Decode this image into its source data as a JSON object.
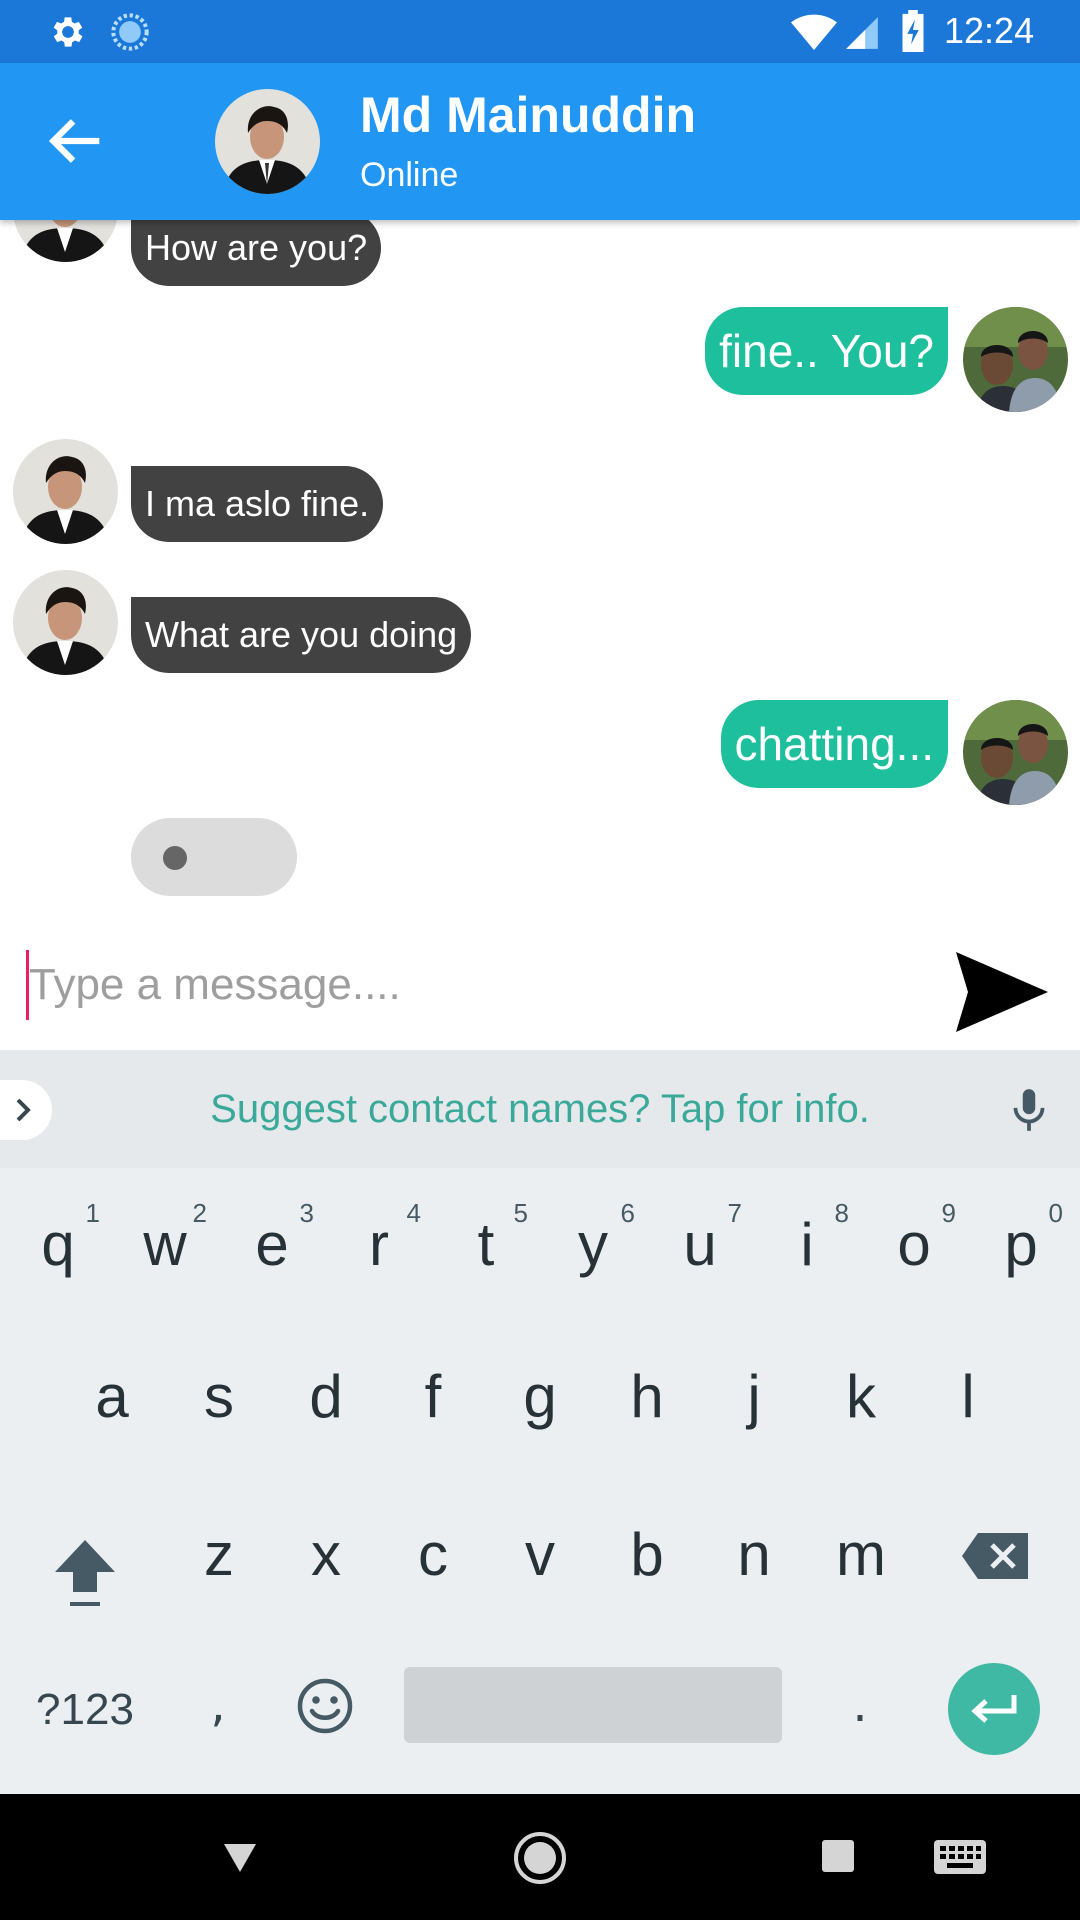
{
  "status_bar": {
    "time": "12:24"
  },
  "toolbar": {
    "contact_name": "Md Mainuddin",
    "contact_status": "Online"
  },
  "messages": [
    {
      "side": "in",
      "text": "How are you?"
    },
    {
      "side": "out",
      "text": "fine.. You?"
    },
    {
      "side": "in",
      "text": "I ma aslo fine."
    },
    {
      "side": "in",
      "text": "What are you doing"
    },
    {
      "side": "out",
      "text": "chatting..."
    }
  ],
  "composer": {
    "placeholder": "Type a message....",
    "value": ""
  },
  "keyboard": {
    "suggestion": "Suggest contact names? Tap for info.",
    "row1": [
      {
        "key": "q",
        "hint": "1"
      },
      {
        "key": "w",
        "hint": "2"
      },
      {
        "key": "e",
        "hint": "3"
      },
      {
        "key": "r",
        "hint": "4"
      },
      {
        "key": "t",
        "hint": "5"
      },
      {
        "key": "y",
        "hint": "6"
      },
      {
        "key": "u",
        "hint": "7"
      },
      {
        "key": "i",
        "hint": "8"
      },
      {
        "key": "o",
        "hint": "9"
      },
      {
        "key": "p",
        "hint": "0"
      }
    ],
    "row2": [
      "a",
      "s",
      "d",
      "f",
      "g",
      "h",
      "j",
      "k",
      "l"
    ],
    "row3": [
      "z",
      "x",
      "c",
      "v",
      "b",
      "n",
      "m"
    ],
    "symbols_label": "?123",
    "comma": ",",
    "period": "."
  },
  "colors": {
    "status_bar": "#1c78d8",
    "toolbar": "#2196f3",
    "incoming_bubble": "#424242",
    "outgoing_bubble": "#1dbf9c",
    "enter_key": "#3fb8a4"
  },
  "icons": [
    "gear-icon",
    "sync-icon",
    "wifi-icon",
    "signal-icon",
    "battery-icon",
    "back-arrow-icon",
    "send-icon",
    "chevron-right-icon",
    "mic-icon",
    "shift-icon",
    "backspace-icon",
    "emoji-icon",
    "enter-icon",
    "nav-back-icon",
    "nav-home-icon",
    "nav-recent-icon",
    "keyboard-icon"
  ]
}
